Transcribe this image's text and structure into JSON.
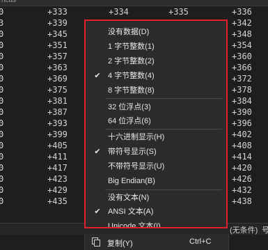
{
  "title_fragment": "ncas",
  "rows": [
    [
      "0",
      "+333",
      "+334",
      "+335",
      "+336"
    ],
    [
      "3",
      "+339",
      "",
      "",
      "+342"
    ],
    [
      "0",
      "+345",
      "",
      "",
      "+348"
    ],
    [
      "0",
      "+351",
      "",
      "",
      "+354"
    ],
    [
      "0",
      "+357",
      "",
      "",
      "+360"
    ],
    [
      "0",
      "+363",
      "",
      "",
      "+366"
    ],
    [
      "0",
      "+369",
      "",
      "",
      "+372"
    ],
    [
      "0",
      "+375",
      "",
      "",
      "+378"
    ],
    [
      "0",
      "+381",
      "",
      "",
      "+384"
    ],
    [
      "0",
      "+387",
      "",
      "",
      "+390"
    ],
    [
      "0",
      "+393",
      "",
      "",
      "+396"
    ],
    [
      "0",
      "+399",
      "",
      "",
      "+402"
    ],
    [
      "0",
      "+405",
      "",
      "",
      "+408"
    ],
    [
      "0",
      "+411",
      "",
      "",
      "+414"
    ],
    [
      "0",
      "+417",
      "",
      "",
      "+420"
    ],
    [
      "0",
      "+423",
      "",
      "",
      "+426"
    ],
    [
      "0",
      "+429",
      "",
      "",
      "+432"
    ],
    [
      "0",
      "+435",
      "",
      "",
      "+438"
    ]
  ],
  "menu": {
    "items": [
      {
        "label": "没有数据(D)",
        "checked": ""
      },
      {
        "label": "1 字节整数(1)",
        "checked": ""
      },
      {
        "label": "2 字节整数(2)",
        "checked": ""
      },
      {
        "label": "4 字节整数(4)",
        "checked": "✔"
      },
      {
        "label": "8 字节整数(8)",
        "checked": ""
      },
      {
        "label": "32 位浮点(3)",
        "checked": ""
      },
      {
        "label": "64 位浮点(6)",
        "checked": ""
      },
      {
        "label": "十六进制显示(H)",
        "checked": ""
      },
      {
        "label": "带符号显示(S)",
        "checked": "✔"
      },
      {
        "label": "不带符号显示(U)",
        "checked": ""
      },
      {
        "label": "Big Endian(B)",
        "checked": ""
      },
      {
        "label": "没有文本(N)",
        "checked": ""
      },
      {
        "label": "ANSI 文本(A)",
        "checked": "✔"
      },
      {
        "label": "Unicode 文本(I)",
        "checked": ""
      }
    ]
  },
  "copy": {
    "label": "复制(Y)",
    "shortcut": "Ctrl+C",
    "icon": "copy-icon"
  },
  "status": {
    "condition": "(无条件)",
    "tail": "号"
  },
  "colors": {
    "menu_border": "#e0202a",
    "menu_bg": "#2b2b2b",
    "background": "#1e1e1e"
  }
}
